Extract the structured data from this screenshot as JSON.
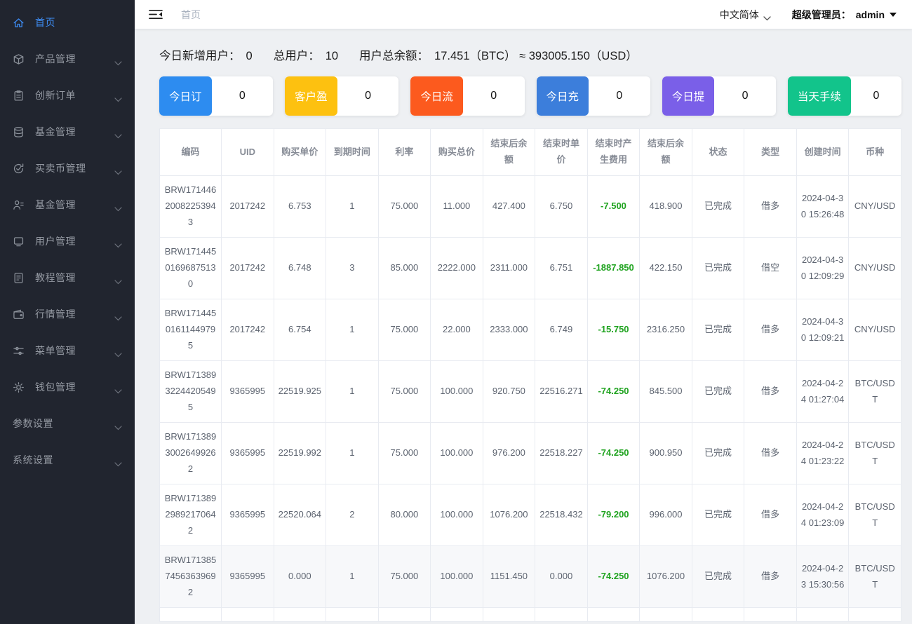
{
  "colors": {
    "accent": "#3e8ef7",
    "negative_fee_green": "#1fa31f"
  },
  "sidebar": {
    "items": [
      {
        "name": "home",
        "label": "首页",
        "icon": "home-icon",
        "active": true,
        "chevron": false
      },
      {
        "name": "products",
        "label": "产品管理",
        "icon": "product-icon",
        "active": false,
        "chevron": true
      },
      {
        "name": "new-orders",
        "label": "创新订单",
        "icon": "order-icon",
        "active": false,
        "chevron": true
      },
      {
        "name": "funds",
        "label": "基金管理",
        "icon": "fund-icon",
        "active": false,
        "chevron": true
      },
      {
        "name": "coin-trade",
        "label": "买卖币管理",
        "icon": "trade-icon",
        "active": false,
        "chevron": true
      },
      {
        "name": "fund-users",
        "label": "基金管理",
        "icon": "user-fund-icon",
        "active": false,
        "chevron": true
      },
      {
        "name": "users",
        "label": "用户管理",
        "icon": "user-icon",
        "active": false,
        "chevron": true
      },
      {
        "name": "tutorials",
        "label": "教程管理",
        "icon": "tutorial-icon",
        "active": false,
        "chevron": true
      },
      {
        "name": "market",
        "label": "行情管理",
        "icon": "market-icon",
        "active": false,
        "chevron": true
      },
      {
        "name": "menus",
        "label": "菜单管理",
        "icon": "menu-icon",
        "active": false,
        "chevron": true
      },
      {
        "name": "wallets",
        "label": "钱包管理",
        "icon": "gear-icon",
        "active": false,
        "chevron": true
      },
      {
        "name": "parameters",
        "label": "参数设置",
        "icon": null,
        "active": false,
        "chevron": true
      },
      {
        "name": "system",
        "label": "系统设置",
        "icon": null,
        "active": false,
        "chevron": true
      }
    ]
  },
  "topbar": {
    "breadcrumb": "首页",
    "language": "中文简体",
    "admin_label": "超级管理员：",
    "admin_name": "admin"
  },
  "stats": {
    "new_users_label": "今日新增用户：",
    "new_users_value": "0",
    "total_users_label": "总用户：",
    "total_users_value": "10",
    "balance_label": "用户总余额：",
    "balance_value": "17.451（BTC） ≈ 393005.150（USD）"
  },
  "cards": [
    {
      "name": "today-orders",
      "label": "今日订",
      "value": "0",
      "color": "#2d8cf0"
    },
    {
      "name": "customer-profit",
      "label": "客户盈",
      "value": "0",
      "color": "#fdc110"
    },
    {
      "name": "today-flow",
      "label": "今日流",
      "value": "0",
      "color": "#fc5a1e"
    },
    {
      "name": "today-recharge",
      "label": "今日充",
      "value": "0",
      "color": "#3c7edb"
    },
    {
      "name": "today-withdraw",
      "label": "今日提",
      "value": "0",
      "color": "#7a5fe8"
    },
    {
      "name": "today-fee",
      "label": "当天手续",
      "value": "0",
      "color": "#12c48b"
    }
  ],
  "table": {
    "columns": [
      "编码",
      "UID",
      "购买单价",
      "到期时间",
      "利率",
      "购买总价",
      "结束后余额",
      "结束时单价",
      "结束时产生费用",
      "结束后余额",
      "状态",
      "类型",
      "创建时间",
      "币种"
    ],
    "fee_column_index": 8,
    "show_partial_next_row": true,
    "rows": [
      {
        "shaded": false,
        "cells": [
          "BRW17144620082253943",
          "2017242",
          "6.753",
          "1",
          "75.000",
          "11.000",
          "427.400",
          "6.750",
          "-7.500",
          "418.900",
          "已完成",
          "借多",
          "2024-04-30 15:26:48",
          "CNY/USD"
        ]
      },
      {
        "shaded": false,
        "cells": [
          "BRW17144501696875130",
          "2017242",
          "6.748",
          "3",
          "85.000",
          "2222.000",
          "2311.000",
          "6.751",
          "-1887.850",
          "422.150",
          "已完成",
          "借空",
          "2024-04-30 12:09:29",
          "CNY/USD"
        ]
      },
      {
        "shaded": false,
        "cells": [
          "BRW17144501611449795",
          "2017242",
          "6.754",
          "1",
          "75.000",
          "22.000",
          "2333.000",
          "6.749",
          "-15.750",
          "2316.250",
          "已完成",
          "借多",
          "2024-04-30 12:09:21",
          "CNY/USD"
        ]
      },
      {
        "shaded": false,
        "cells": [
          "BRW17138932244205495",
          "9365995",
          "22519.925",
          "1",
          "75.000",
          "100.000",
          "920.750",
          "22516.271",
          "-74.250",
          "845.500",
          "已完成",
          "借多",
          "2024-04-24 01:27:04",
          "BTC/USDT"
        ]
      },
      {
        "shaded": false,
        "cells": [
          "BRW17138930026499262",
          "9365995",
          "22519.992",
          "1",
          "75.000",
          "100.000",
          "976.200",
          "22518.227",
          "-74.250",
          "900.950",
          "已完成",
          "借多",
          "2024-04-24 01:23:22",
          "BTC/USDT"
        ]
      },
      {
        "shaded": false,
        "cells": [
          "BRW17138929892170642",
          "9365995",
          "22520.064",
          "2",
          "80.000",
          "100.000",
          "1076.200",
          "22518.432",
          "-79.200",
          "996.000",
          "已完成",
          "借多",
          "2024-04-24 01:23:09",
          "BTC/USDT"
        ]
      },
      {
        "shaded": true,
        "cells": [
          "BRW17138574563639692",
          "9365995",
          "0.000",
          "1",
          "75.000",
          "100.000",
          "1151.450",
          "0.000",
          "-74.250",
          "1076.200",
          "已完成",
          "借多",
          "2024-04-23 15:30:56",
          "BTC/USDT"
        ]
      }
    ]
  }
}
